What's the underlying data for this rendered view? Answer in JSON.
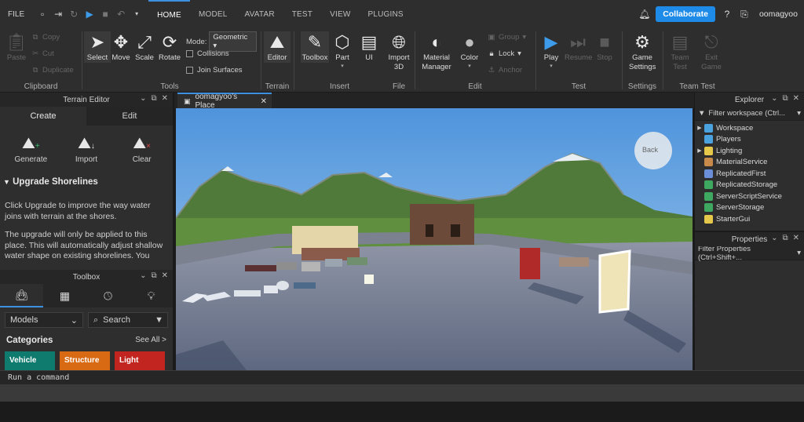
{
  "menubar": {
    "file_label": "FILE",
    "tabs": [
      "HOME",
      "MODEL",
      "AVATAR",
      "TEST",
      "VIEW",
      "PLUGINS"
    ],
    "active_tab": "HOME",
    "collaborate_label": "Collaborate",
    "username": "oomagyoo"
  },
  "ribbon": {
    "clipboard": {
      "label": "Clipboard",
      "paste": "Paste",
      "copy": "Copy",
      "cut": "Cut",
      "duplicate": "Duplicate"
    },
    "tools": {
      "label": "Tools",
      "select": "Select",
      "move": "Move",
      "scale": "Scale",
      "rotate": "Rotate",
      "mode_label": "Mode:",
      "mode_value": "Geometric",
      "collisions": "Collisions",
      "join_surfaces": "Join Surfaces"
    },
    "terrain": {
      "label": "Terrain",
      "editor": "Editor"
    },
    "insert": {
      "label": "Insert",
      "toolbox": "Toolbox",
      "part": "Part",
      "ui": "UI"
    },
    "file": {
      "label": "File",
      "import3d_line1": "Import",
      "import3d_line2": "3D"
    },
    "edit": {
      "label": "Edit",
      "material_line1": "Material",
      "material_line2": "Manager",
      "color": "Color",
      "group": "Group",
      "lock": "Lock",
      "anchor": "Anchor"
    },
    "test": {
      "label": "Test",
      "play": "Play",
      "resume": "Resume",
      "stop": "Stop"
    },
    "settings": {
      "label": "Settings",
      "game_line1": "Game",
      "game_line2": "Settings"
    },
    "team_test": {
      "label": "Team Test",
      "team_line1": "Team",
      "team_line2": "Test",
      "exit_line1": "Exit",
      "exit_line2": "Game"
    }
  },
  "terrain_editor": {
    "title": "Terrain Editor",
    "tabs": [
      "Create",
      "Edit"
    ],
    "active_tab": "Create",
    "tools": [
      "Generate",
      "Import",
      "Clear"
    ],
    "section_title": "Upgrade Shorelines",
    "para1": "Click Upgrade to improve the way water joins with terrain at the shores.",
    "para2": "The upgrade will only be applied to this place. This will automatically adjust shallow water shape on existing shorelines. You"
  },
  "toolbox": {
    "title": "Toolbox",
    "dropdown_value": "Models",
    "search_placeholder": "Search",
    "categories_label": "Categories",
    "see_all": "See All >",
    "chips": [
      "Vehicle",
      "Structure",
      "Light"
    ],
    "chip_colors": [
      "#0f7a6e",
      "#d96a14",
      "#c2241f"
    ]
  },
  "viewport": {
    "tab_title": "oomagyoo's Place",
    "back_label": "Back"
  },
  "explorer": {
    "title": "Explorer",
    "filter_placeholder": "Filter workspace (Ctrl...",
    "items": [
      {
        "name": "Workspace",
        "expandable": true,
        "color": "#4aa3df"
      },
      {
        "name": "Players",
        "expandable": false,
        "color": "#4aa3df"
      },
      {
        "name": "Lighting",
        "expandable": true,
        "color": "#e6c84a"
      },
      {
        "name": "MaterialService",
        "expandable": false,
        "color": "#c88a4a"
      },
      {
        "name": "ReplicatedFirst",
        "expandable": false,
        "color": "#6a8fd8"
      },
      {
        "name": "ReplicatedStorage",
        "expandable": false,
        "color": "#3fa860"
      },
      {
        "name": "ServerScriptService",
        "expandable": false,
        "color": "#3fa860"
      },
      {
        "name": "ServerStorage",
        "expandable": false,
        "color": "#3fa860"
      },
      {
        "name": "StarterGui",
        "expandable": false,
        "color": "#e6c84a"
      }
    ]
  },
  "properties": {
    "title": "Properties",
    "filter_placeholder": "Filter Properties (Ctrl+Shift+..."
  },
  "command_bar": {
    "placeholder": "Run a command"
  }
}
